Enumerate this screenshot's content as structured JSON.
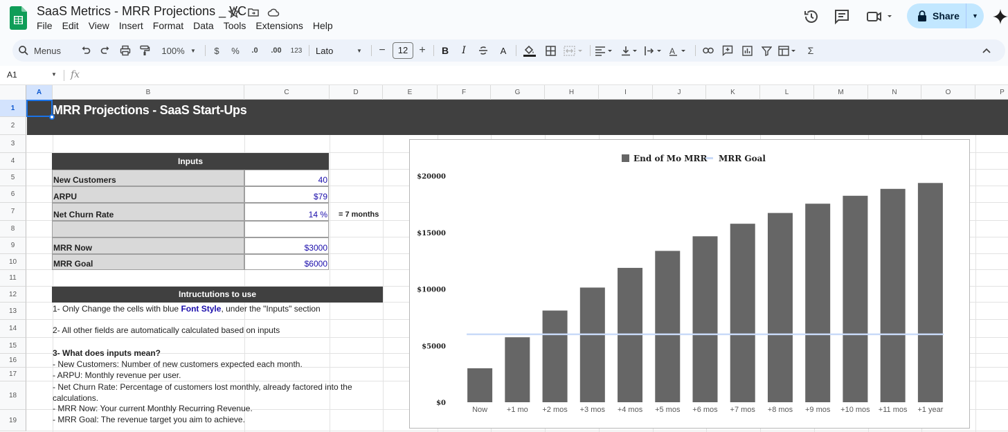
{
  "app": {
    "title": "SaaS Metrics - MRR Projections _ VC",
    "menus": [
      "File",
      "Edit",
      "View",
      "Insert",
      "Format",
      "Data",
      "Tools",
      "Extensions",
      "Help"
    ],
    "share_label": "Share"
  },
  "toolbar": {
    "search_label": "Menus",
    "zoom": "100%",
    "currency": "$",
    "percent": "%",
    "decrease_decimal": ".0",
    "increase_decimal": ".00",
    "number_format": "123",
    "font": "Lato",
    "font_size": "12",
    "minus": "−",
    "plus": "+",
    "bold": "B",
    "italic": "I",
    "text_color": "A",
    "sum": "Σ"
  },
  "formula_bar": {
    "cell_ref": "A1",
    "fx": "fx"
  },
  "columns": [
    "A",
    "B",
    "C",
    "D",
    "E",
    "F",
    "G",
    "H",
    "I",
    "J",
    "K",
    "L",
    "M",
    "N",
    "O",
    "P"
  ],
  "rows": [
    "1",
    "2",
    "3",
    "4",
    "5",
    "6",
    "7",
    "8",
    "9",
    "10",
    "11",
    "12",
    "13",
    "14",
    "15",
    "16",
    "17",
    "18",
    "19"
  ],
  "sheet": {
    "title": "MRR Projections - SaaS Start-Ups",
    "inputs_header": "Inputs",
    "inputs": [
      {
        "label": "New Customers",
        "value": "40"
      },
      {
        "label": "ARPU",
        "value": "$79"
      },
      {
        "label": "Net Churn Rate",
        "value": "14 %"
      },
      {
        "label": "",
        "value": ""
      },
      {
        "label": "MRR Now",
        "value": "$3000"
      },
      {
        "label": "MRR Goal",
        "value": "$6000"
      }
    ],
    "churn_note": "= 7 months",
    "instructions_header": "Intructutions to use",
    "instr_1_a": "1- Only Change the cells with blue ",
    "instr_1_b": "Font Style",
    "instr_1_c": ", under the \"Inputs\" section",
    "instr_2": "2- All other fields are automatically calculated based on inputs",
    "instr_3": "3- What does inputs mean?",
    "instr_4": "- New Customers: Number of new customers expected each month.",
    "instr_5": "- ARPU: Monthly revenue per user.",
    "instr_6": "- Net Churn Rate: Percentage of customers lost monthly, already factored into the",
    "instr_7": "calculations.",
    "instr_8": "- MRR Now: Your current Monthly Recurring Revenue.",
    "instr_9": "- MRR Goal: The revenue target you aim to achieve."
  },
  "chart_data": {
    "type": "bar",
    "categories": [
      "Now",
      "+1 mo",
      "+2 mos",
      "+3 mos",
      "+4 mos",
      "+5 mos",
      "+6 mos",
      "+7 mos",
      "+8 mos",
      "+9 mos",
      "+10 mos",
      "+11 mos",
      "+1 year"
    ],
    "series": [
      {
        "name": "End of Mo MRR",
        "type": "bar",
        "color": "#666666",
        "values": [
          3000,
          5740,
          8100,
          10130,
          11870,
          13370,
          14660,
          15770,
          16720,
          17540,
          18240,
          18850,
          19370
        ]
      },
      {
        "name": "MRR Goal",
        "type": "line",
        "color": "#c9daf8",
        "values": [
          6000,
          6000,
          6000,
          6000,
          6000,
          6000,
          6000,
          6000,
          6000,
          6000,
          6000,
          6000,
          6000
        ]
      }
    ],
    "yticks": [
      "$0",
      "$5000",
      "$10000",
      "$15000",
      "$20000"
    ],
    "ylim": [
      0,
      20000
    ],
    "legend_position": "top"
  }
}
